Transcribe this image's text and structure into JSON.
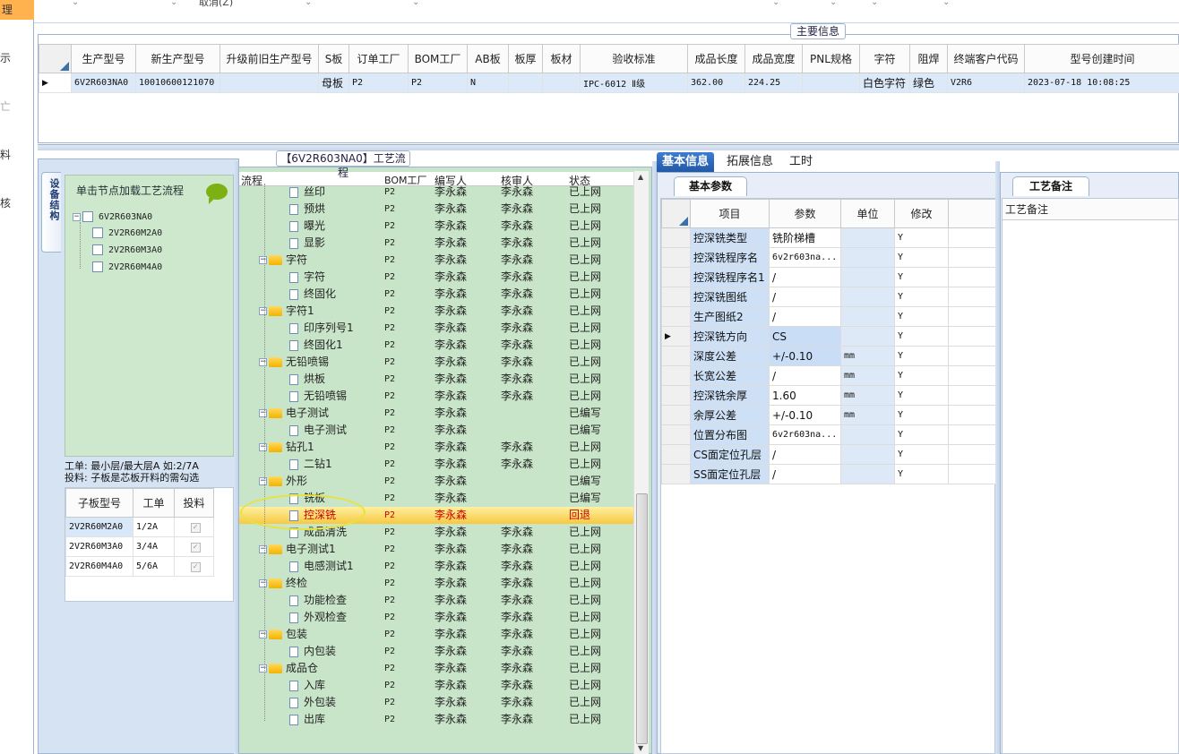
{
  "left_nav": {
    "selected": "理",
    "items": [
      "示",
      "亡",
      "料",
      "核"
    ]
  },
  "top_strip": {
    "cancel_label": "取消(Z)"
  },
  "main_info": {
    "title": "主要信息",
    "columns": [
      "生产型号",
      "新生产型号",
      "升级前旧生产型号",
      "S板",
      "订单工厂",
      "BOM工厂",
      "AB板",
      "板厚",
      "板材",
      "验收标准",
      "成品长度",
      "成品宽度",
      "PNL规格",
      "字符",
      "阻焊",
      "终端客户代码",
      "型号创建时间"
    ],
    "rows": [
      [
        "6V2R603NA0",
        "10010600121070",
        "",
        "母板",
        "P2",
        "P2",
        "N",
        "",
        "",
        "IPC-6012 Ⅱ级",
        "362.00",
        "224.25",
        "",
        "白色字符",
        "绿色",
        "V2R6",
        "2023-07-18 10:08:25"
      ]
    ]
  },
  "device_structure": {
    "side_tab": "设备结构",
    "hint": "单击节点加载工艺流程",
    "root": "6V2R603NA0",
    "children": [
      "2V2R60M2A0",
      "2V2R60M3A0",
      "2V2R60M4A0"
    ],
    "info_line1": "工单: 最小层/最大层A 如:2/7A",
    "info_line2": "投料: 子板是芯板开料的需勾选"
  },
  "sub_boards": {
    "columns": [
      "子板型号",
      "工单",
      "投料"
    ],
    "rows": [
      {
        "model": "2V2R60M2A0",
        "order": "1/2A",
        "checked": true
      },
      {
        "model": "2V2R60M3A0",
        "order": "3/4A",
        "checked": true
      },
      {
        "model": "2V2R60M4A0",
        "order": "5/6A",
        "checked": true
      }
    ]
  },
  "process": {
    "title": "【6V2R603NA0】工艺流程",
    "columns": [
      "流程",
      "BOM工厂",
      "编写人",
      "核审人",
      "状态"
    ],
    "rows": [
      {
        "name": "丝印",
        "level": 2,
        "bom": "P2",
        "writer": "李永森",
        "reviewer": "李永森",
        "status": "已上网"
      },
      {
        "name": "预烘",
        "level": 2,
        "bom": "P2",
        "writer": "李永森",
        "reviewer": "李永森",
        "status": "已上网"
      },
      {
        "name": "曝光",
        "level": 2,
        "bom": "P2",
        "writer": "李永森",
        "reviewer": "李永森",
        "status": "已上网"
      },
      {
        "name": "显影",
        "level": 2,
        "bom": "P2",
        "writer": "李永森",
        "reviewer": "李永森",
        "status": "已上网"
      },
      {
        "name": "字符",
        "level": 1,
        "bom": "P2",
        "writer": "李永森",
        "reviewer": "李永森",
        "status": "已上网"
      },
      {
        "name": "字符",
        "level": 2,
        "bom": "P2",
        "writer": "李永森",
        "reviewer": "李永森",
        "status": "已上网"
      },
      {
        "name": "终固化",
        "level": 2,
        "bom": "P2",
        "writer": "李永森",
        "reviewer": "李永森",
        "status": "已上网"
      },
      {
        "name": "字符1",
        "level": 1,
        "bom": "P2",
        "writer": "李永森",
        "reviewer": "李永森",
        "status": "已上网"
      },
      {
        "name": "印序列号1",
        "level": 2,
        "bom": "P2",
        "writer": "李永森",
        "reviewer": "李永森",
        "status": "已上网"
      },
      {
        "name": "终固化1",
        "level": 2,
        "bom": "P2",
        "writer": "李永森",
        "reviewer": "李永森",
        "status": "已上网"
      },
      {
        "name": "无铅喷锡",
        "level": 1,
        "bom": "P2",
        "writer": "李永森",
        "reviewer": "李永森",
        "status": "已上网"
      },
      {
        "name": "烘板",
        "level": 2,
        "bom": "P2",
        "writer": "李永森",
        "reviewer": "李永森",
        "status": "已上网"
      },
      {
        "name": "无铅喷锡",
        "level": 2,
        "bom": "P2",
        "writer": "李永森",
        "reviewer": "李永森",
        "status": "已上网"
      },
      {
        "name": "电子测试",
        "level": 1,
        "bom": "P2",
        "writer": "李永森",
        "reviewer": "",
        "status": "已编写"
      },
      {
        "name": "电子测试",
        "level": 2,
        "bom": "P2",
        "writer": "李永森",
        "reviewer": "",
        "status": "已编写"
      },
      {
        "name": "钻孔1",
        "level": 1,
        "bom": "P2",
        "writer": "李永森",
        "reviewer": "李永森",
        "status": "已上网"
      },
      {
        "name": "二钻1",
        "level": 2,
        "bom": "P2",
        "writer": "李永森",
        "reviewer": "李永森",
        "status": "已上网"
      },
      {
        "name": "外形",
        "level": 1,
        "bom": "P2",
        "writer": "李永森",
        "reviewer": "",
        "status": "已编写"
      },
      {
        "name": "铣板",
        "level": 2,
        "bom": "P2",
        "writer": "李永森",
        "reviewer": "",
        "status": "已编写"
      },
      {
        "name": "控深铣",
        "level": 2,
        "bom": "P2",
        "writer": "李永森",
        "reviewer": "",
        "status": "回退",
        "highlight": true
      },
      {
        "name": "成品清洗",
        "level": 2,
        "bom": "P2",
        "writer": "李永森",
        "reviewer": "李永森",
        "status": "已上网"
      },
      {
        "name": "电子测试1",
        "level": 1,
        "bom": "P2",
        "writer": "李永森",
        "reviewer": "李永森",
        "status": "已上网"
      },
      {
        "name": "电感测试1",
        "level": 2,
        "bom": "P2",
        "writer": "李永森",
        "reviewer": "李永森",
        "status": "已上网"
      },
      {
        "name": "终检",
        "level": 1,
        "bom": "P2",
        "writer": "李永森",
        "reviewer": "李永森",
        "status": "已上网"
      },
      {
        "name": "功能检查",
        "level": 2,
        "bom": "P2",
        "writer": "李永森",
        "reviewer": "李永森",
        "status": "已上网"
      },
      {
        "name": "外观检查",
        "level": 2,
        "bom": "P2",
        "writer": "李永森",
        "reviewer": "李永森",
        "status": "已上网"
      },
      {
        "name": "包装",
        "level": 1,
        "bom": "P2",
        "writer": "李永森",
        "reviewer": "李永森",
        "status": "已上网"
      },
      {
        "name": "内包装",
        "level": 2,
        "bom": "P2",
        "writer": "李永森",
        "reviewer": "李永森",
        "status": "已上网"
      },
      {
        "name": "成品仓",
        "level": 1,
        "bom": "P2",
        "writer": "李永森",
        "reviewer": "李永森",
        "status": "已上网"
      },
      {
        "name": "入库",
        "level": 2,
        "bom": "P2",
        "writer": "李永森",
        "reviewer": "李永森",
        "status": "已上网"
      },
      {
        "name": "外包装",
        "level": 2,
        "bom": "P2",
        "writer": "李永森",
        "reviewer": "李永森",
        "status": "已上网"
      },
      {
        "name": "出库",
        "level": 2,
        "bom": "P2",
        "writer": "李永森",
        "reviewer": "李永森",
        "status": "已上网"
      }
    ]
  },
  "right_tabs": [
    "基本信息",
    "拓展信息",
    "工时"
  ],
  "basic_params": {
    "tab": "基本参数",
    "columns": [
      "项目",
      "参数",
      "单位",
      "修改"
    ],
    "rows": [
      {
        "item": "控深铣类型",
        "param": "铣阶梯槽",
        "unit": "",
        "mod": "Y"
      },
      {
        "item": "控深铣程序名",
        "param": "6v2r603na...",
        "unit": "",
        "mod": "Y"
      },
      {
        "item": "控深铣程序名1",
        "param": "/",
        "unit": "",
        "mod": "Y"
      },
      {
        "item": "控深铣图纸",
        "param": "/",
        "unit": "",
        "mod": "Y"
      },
      {
        "item": "生产图纸2",
        "param": "/",
        "unit": "",
        "mod": "Y"
      },
      {
        "item": "控深铣方向",
        "param": "CS",
        "unit": "",
        "mod": "Y",
        "current": true
      },
      {
        "item": "深度公差",
        "param": "+/-0.10",
        "unit": "mm",
        "mod": "Y"
      },
      {
        "item": "长宽公差",
        "param": "/",
        "unit": "mm",
        "mod": "Y"
      },
      {
        "item": "控深铣余厚",
        "param": "1.60",
        "unit": "mm",
        "mod": "Y"
      },
      {
        "item": "余厚公差",
        "param": "+/-0.10",
        "unit": "mm",
        "mod": "Y"
      },
      {
        "item": "位置分布图",
        "param": "6v2r603na...",
        "unit": "",
        "mod": "Y"
      },
      {
        "item": "CS面定位孔层",
        "param": "/",
        "unit": "",
        "mod": "Y"
      },
      {
        "item": "SS面定位孔层",
        "param": "/",
        "unit": "",
        "mod": "Y"
      }
    ]
  },
  "process_notes": {
    "tab": "工艺备注",
    "header": "工艺备注"
  }
}
